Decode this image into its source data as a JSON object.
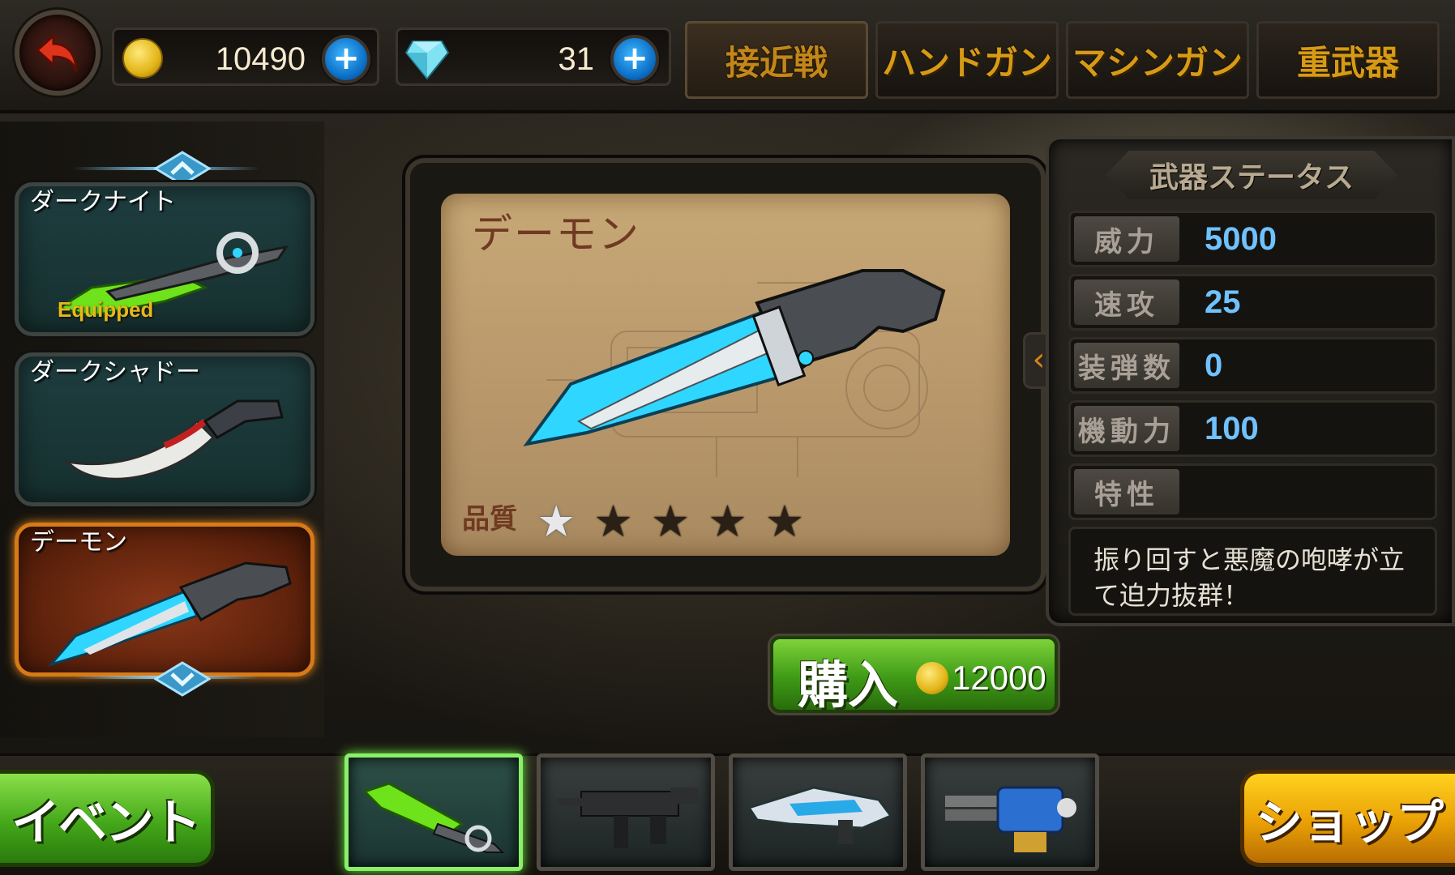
{
  "top_bar": {
    "coins": "10490",
    "gems": "31",
    "plus_label": "+",
    "tabs": [
      {
        "label": "接近戦",
        "active": true
      },
      {
        "label": "ハンドガン",
        "active": false
      },
      {
        "label": "マシンガン",
        "active": false
      },
      {
        "label": "重武器",
        "active": false
      }
    ]
  },
  "weapon_list": {
    "items": [
      {
        "name": "ダークナイト",
        "status": "Equipped",
        "selected": false
      },
      {
        "name": "ダークシャドー",
        "status": "",
        "selected": false
      },
      {
        "name": "デーモン",
        "status": "",
        "selected": true
      }
    ]
  },
  "display": {
    "weapon_name": "デーモン",
    "quality_label": "品質",
    "quality_stars": 1,
    "max_stars": 5
  },
  "stats": {
    "header": "武器ステータス",
    "rows": [
      {
        "label": "威力",
        "value": "5000"
      },
      {
        "label": "速攻",
        "value": "25"
      },
      {
        "label": "装弾数",
        "value": "0"
      },
      {
        "label": "機動力",
        "value": "100"
      },
      {
        "label": "特性",
        "value": ""
      }
    ],
    "description": "振り回すと悪魔の咆哮が立て迫力抜群！"
  },
  "purchase": {
    "label": "購入",
    "price": "12000"
  },
  "bottom_bar": {
    "event_label": "イベント",
    "shop_label": "ショップ",
    "slots": [
      {
        "icon": "green-blade-icon",
        "active": true
      },
      {
        "icon": "submachine-gun-icon",
        "active": false
      },
      {
        "icon": "heavy-rifle-icon",
        "active": false
      },
      {
        "icon": "minigun-icon",
        "active": false
      }
    ]
  },
  "colors": {
    "accent_gold": "#d79a16",
    "stat_value_blue": "#6fc2ff",
    "buy_green": "#3e9a16",
    "shop_yellow": "#e9a005",
    "selected_orange": "#d77a18"
  }
}
